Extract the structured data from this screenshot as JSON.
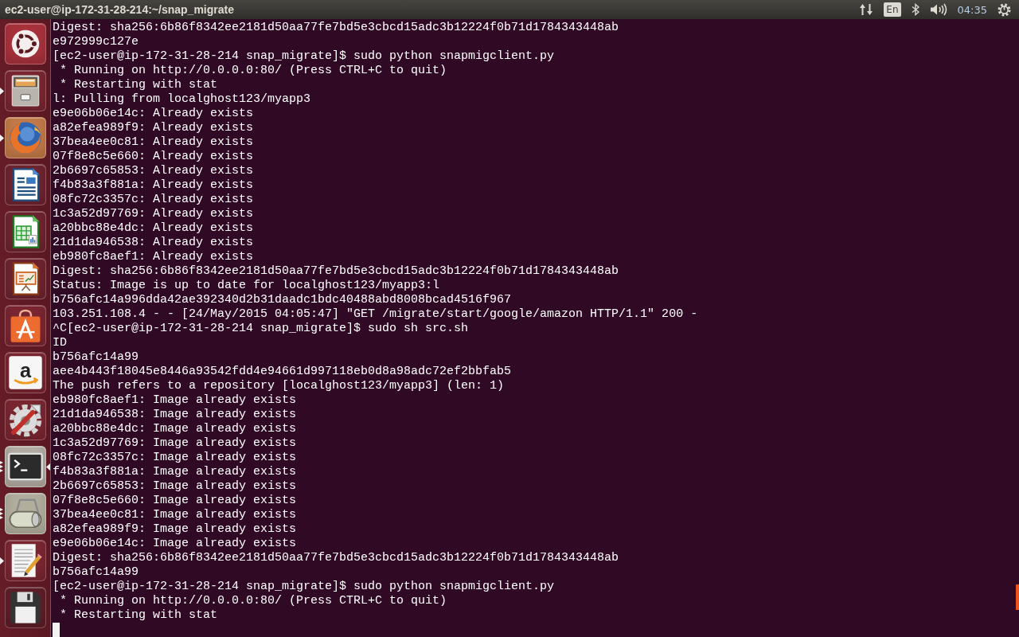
{
  "top_bar": {
    "title": "ec2-user@ip-172-31-28-214:~/snap_migrate",
    "keyboard_layout": "En",
    "clock": "04:35"
  },
  "launcher": {
    "items": [
      {
        "kind": "dash",
        "running": false,
        "focused": false
      },
      {
        "kind": "files",
        "running": true,
        "several_windows": false,
        "focused": false
      },
      {
        "kind": "browser",
        "running": true,
        "several_windows": false,
        "focused": false
      },
      {
        "kind": "writer",
        "running": false,
        "focused": false
      },
      {
        "kind": "calc",
        "running": false,
        "focused": false
      },
      {
        "kind": "impress",
        "running": false,
        "focused": false
      },
      {
        "kind": "software",
        "running": false,
        "focused": false
      },
      {
        "kind": "shop",
        "glyph": "a",
        "running": false,
        "focused": false
      },
      {
        "kind": "settings",
        "running": false,
        "focused": false
      },
      {
        "kind": "terminal",
        "running": true,
        "several_windows": true,
        "focused": true
      },
      {
        "kind": "scanner",
        "running": true,
        "several_windows": true,
        "focused": false
      },
      {
        "kind": "editor",
        "running": true,
        "several_windows": false,
        "focused": false
      },
      {
        "kind": "floppy",
        "running": false,
        "focused": false
      }
    ]
  },
  "terminal": {
    "lines": [
      "Digest: sha256:6b86f8342ee2181d50aa77fe7bd5e3cbcd15adc3b12224f0b71d1784343448ab",
      "e972999c127e",
      "[ec2-user@ip-172-31-28-214 snap_migrate]$ sudo python snapmigclient.py",
      " * Running on http://0.0.0.0:80/ (Press CTRL+C to quit)",
      " * Restarting with stat",
      "l: Pulling from localghost123/myapp3",
      "e9e06b06e14c: Already exists",
      "a82efea989f9: Already exists",
      "37bea4ee0c81: Already exists",
      "07f8e8c5e660: Already exists",
      "2b6697c65853: Already exists",
      "f4b83a3f881a: Already exists",
      "08fc72c3357c: Already exists",
      "1c3a52d97769: Already exists",
      "a20bbc88e4dc: Already exists",
      "21d1da946538: Already exists",
      "eb980fc8aef1: Already exists",
      "Digest: sha256:6b86f8342ee2181d50aa77fe7bd5e3cbcd15adc3b12224f0b71d1784343448ab",
      "Status: Image is up to date for localghost123/myapp3:l",
      "b756afc14a996dda42ae392340d2b31daadc1bdc40488abd8008bcad4516f967",
      "103.251.108.4 - - [24/May/2015 04:05:47] \"GET /migrate/start/google/amazon HTTP/1.1\" 200 -",
      "^C[ec2-user@ip-172-31-28-214 snap_migrate]$ sudo sh src.sh",
      "ID",
      "b756afc14a99",
      "aee4b443f18045e8446a93542fdd4e94661d997118eb0d8a98adc72ef2bbfab5",
      "The push refers to a repository [localghost123/myapp3] (len: 1)",
      "eb980fc8aef1: Image already exists",
      "21d1da946538: Image already exists",
      "a20bbc88e4dc: Image already exists",
      "1c3a52d97769: Image already exists",
      "08fc72c3357c: Image already exists",
      "f4b83a3f881a: Image already exists",
      "2b6697c65853: Image already exists",
      "07f8e8c5e660: Image already exists",
      "37bea4ee0c81: Image already exists",
      "a82efea989f9: Image already exists",
      "e9e06b06e14c: Image already exists",
      "Digest: sha256:6b86f8342ee2181d50aa77fe7bd5e3cbcd15adc3b12224f0b71d1784343448ab",
      "b756afc14a99",
      "[ec2-user@ip-172-31-28-214 snap_migrate]$ sudo python snapmigclient.py",
      " * Running on http://0.0.0.0:80/ (Press CTRL+C to quit)",
      " * Restarting with stat"
    ],
    "cursor": true
  }
}
